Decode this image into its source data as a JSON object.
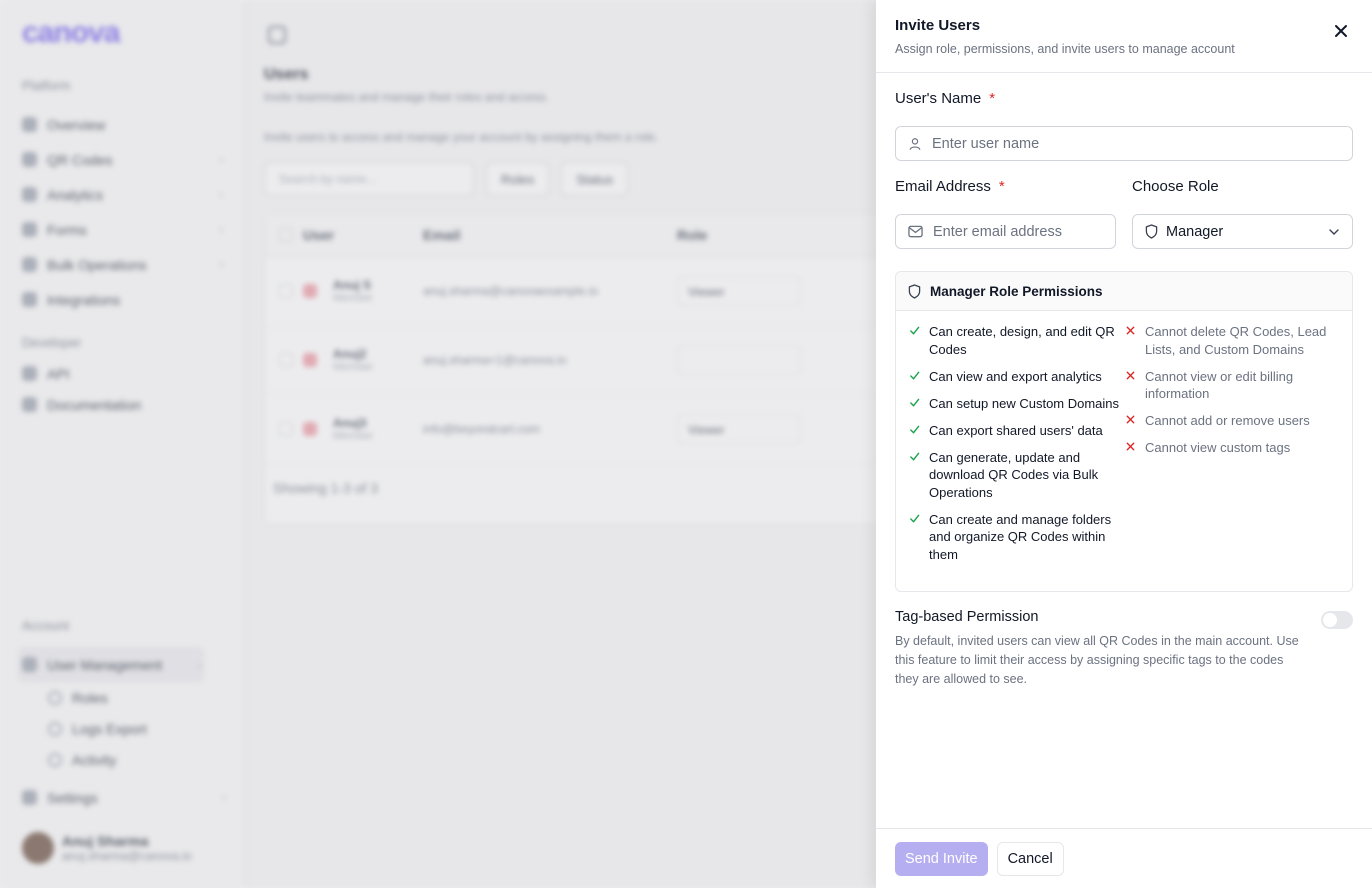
{
  "background": {
    "logo": "canova",
    "sidebar": {
      "platform_label": "Platform",
      "platform_items": [
        {
          "label": "Overview",
          "chev": ""
        },
        {
          "label": "QR Codes",
          "chev": "›"
        },
        {
          "label": "Analytics",
          "chev": "›"
        },
        {
          "label": "Forms",
          "chev": "›"
        },
        {
          "label": "Bulk Operations",
          "chev": "›"
        },
        {
          "label": "Integrations",
          "chev": ""
        }
      ],
      "developer_label": "Developer",
      "developer_items": [
        {
          "label": "API"
        },
        {
          "label": "Documentation"
        }
      ],
      "account_label": "Account",
      "user_management": "User Management",
      "sub_items": [
        "Roles",
        "Logs Export",
        "Activity"
      ],
      "settings": "Settings",
      "user_name": "Anuj Sharma",
      "user_email": "anuj.sharma@canova.io"
    },
    "main": {
      "title": "Users",
      "subtitle": "Invite teammates and manage their roles and access.",
      "description": "Invite users to access and manage your account by assigning them a role.",
      "search_placeholder": "Search by name...",
      "filter_roles": "Roles",
      "filter_status": "Status",
      "columns": [
        "User",
        "Email",
        "Role"
      ],
      "rows": [
        {
          "name": "Anuj S",
          "role": "Member",
          "email": "anuj.sharma@canovaexample.io",
          "select": "Viewer"
        },
        {
          "name": "Anuj2",
          "role": "Member",
          "email": "anuj.sharma+1@canova.io",
          "select": ""
        },
        {
          "name": "Anuj3",
          "role": "Member",
          "email": "info@beyondcart.com",
          "select": "Viewer"
        }
      ],
      "showing": "Showing 1-3 of 3"
    }
  },
  "drawer": {
    "title": "Invite Users",
    "subtitle": "Assign role, permissions, and invite users to manage account",
    "name_label": "User's Name",
    "name_placeholder": "Enter user name",
    "email_label": "Email Address",
    "email_placeholder": "Enter email address",
    "role_label": "Choose Role",
    "role_value": "Manager",
    "required_mark": "*",
    "permissions_title": "Manager Role Permissions",
    "allowed": [
      "Can create, design, and edit QR Codes",
      "Can view and export analytics",
      "Can setup new Custom Domains",
      "Can export shared users' data",
      "Can generate, update and download QR Codes via Bulk Operations",
      "Can create and manage folders and organize QR Codes within them"
    ],
    "denied": [
      "Cannot delete QR Codes, Lead Lists, and Custom Domains",
      "Cannot view or edit billing information",
      "Cannot add or remove users",
      "Cannot view custom tags"
    ],
    "tag_title": "Tag-based Permission",
    "tag_description": "By default, invited users can view all QR Codes in the main account. Use this feature to limit their access by assigning specific tags to the codes they are allowed to see.",
    "send_label": "Send Invite",
    "cancel_label": "Cancel"
  },
  "colors": {
    "accent": "#6d5cf0",
    "accent_disabled": "#b5aef0",
    "check": "#16a34a",
    "cross": "#dc2626"
  }
}
